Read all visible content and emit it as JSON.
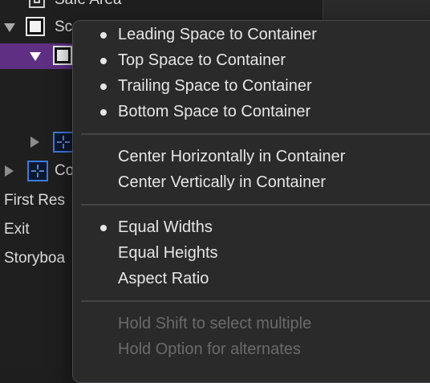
{
  "outline": {
    "rows": [
      {
        "label": "Safe Area"
      },
      {
        "label": "Sc"
      },
      {
        "label": ""
      },
      {
        "label": ""
      },
      {
        "label": "Co"
      },
      {
        "label": "First Res"
      },
      {
        "label": "Exit"
      },
      {
        "label": "Storyboa"
      }
    ]
  },
  "menu": {
    "constraints": [
      {
        "label": "Leading Space to Container",
        "checked": true
      },
      {
        "label": "Top Space to Container",
        "checked": true
      },
      {
        "label": "Trailing Space to Container",
        "checked": true
      },
      {
        "label": "Bottom Space to Container",
        "checked": true
      }
    ],
    "center": [
      {
        "label": "Center Horizontally in Container"
      },
      {
        "label": "Center Vertically in Container"
      }
    ],
    "size": [
      {
        "label": "Equal Widths",
        "checked": true
      },
      {
        "label": "Equal Heights"
      },
      {
        "label": "Aspect Ratio"
      }
    ],
    "hints": [
      {
        "label": "Hold Shift to select multiple"
      },
      {
        "label": "Hold Option for alternates"
      }
    ]
  },
  "colors": {
    "selection": "#5e2f83",
    "menu_bg": "#2a2a2b",
    "accent_blue": "#3d7bdc"
  }
}
